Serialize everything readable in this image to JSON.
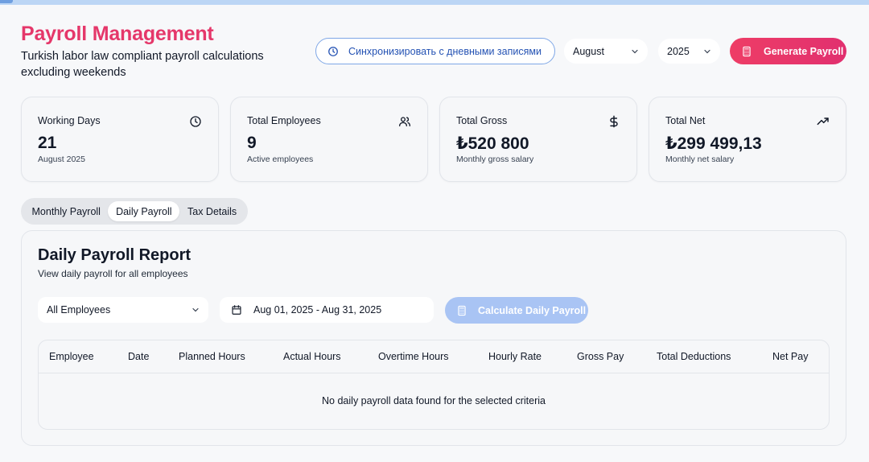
{
  "header": {
    "title": "Payroll Management",
    "subtitle": "Turkish labor law compliant payroll calculations excluding weekends"
  },
  "toolbar": {
    "sync_label": "Синхронизировать с дневными записями",
    "month_value": "August",
    "year_value": "2025",
    "generate_label": "Generate Payroll"
  },
  "stats": [
    {
      "label": "Working Days",
      "value": "21",
      "note": "August 2025",
      "icon": "clock-icon"
    },
    {
      "label": "Total Employees",
      "value": "9",
      "note": "Active employees",
      "icon": "users-icon"
    },
    {
      "label": "Total Gross",
      "value": "₺520 800",
      "note": "Monthly gross salary",
      "icon": "dollar-icon"
    },
    {
      "label": "Total Net",
      "value": "₺299 499,13",
      "note": "Monthly net salary",
      "icon": "trending-up-icon"
    }
  ],
  "tabs": [
    "Monthly Payroll",
    "Daily Payroll",
    "Tax Details"
  ],
  "active_tab": "Daily Payroll",
  "report": {
    "title": "Daily Payroll Report",
    "subtitle": "View daily payroll for all employees",
    "employee_filter": "All Employees",
    "date_range": "Aug 01, 2025 - Aug 31, 2025",
    "calculate_label": "Calculate Daily Payroll",
    "columns": [
      "Employee",
      "Date",
      "Planned Hours",
      "Actual Hours",
      "Overtime Hours",
      "Hourly Rate",
      "Gross Pay",
      "Total Deductions",
      "Net Pay"
    ],
    "empty_message": "No daily payroll data found for the selected criteria"
  },
  "colors": {
    "brand": "#e5376a",
    "accent_blue": "#2452b3",
    "disabled_blue": "#a9c4f4"
  }
}
